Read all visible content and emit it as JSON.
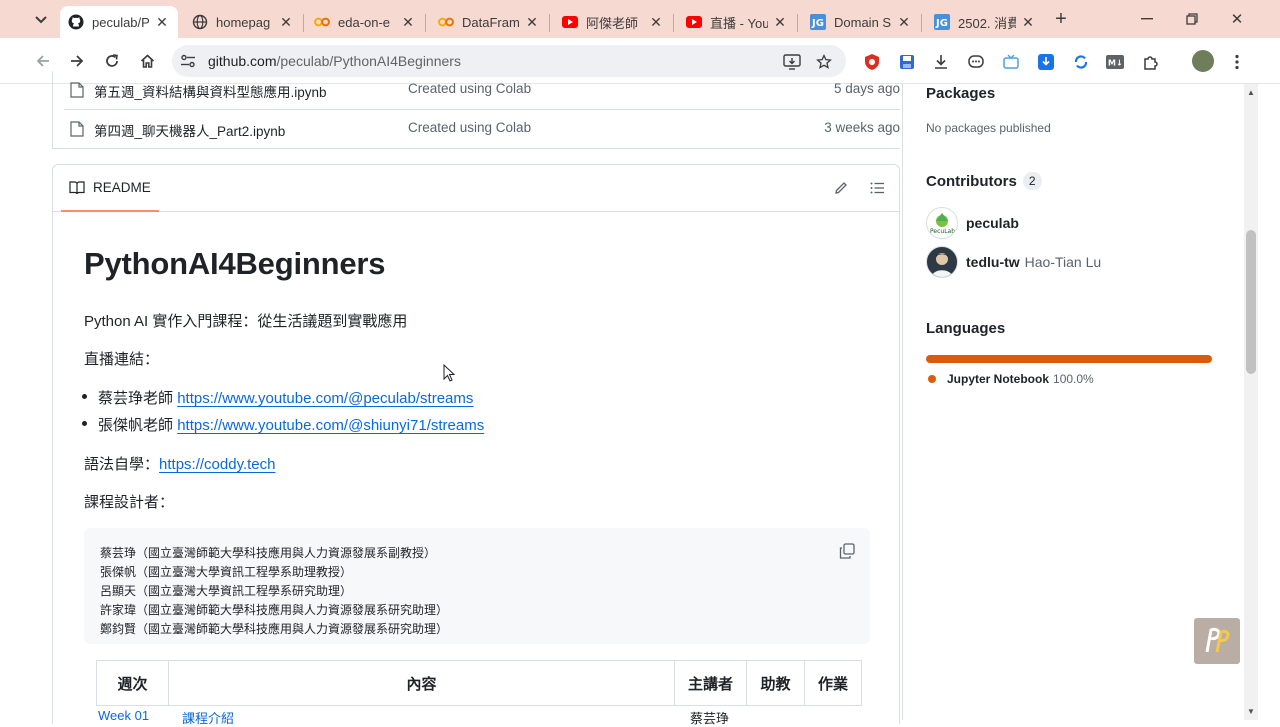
{
  "browser": {
    "tabs": [
      {
        "title": "peculab/P",
        "icon": "github-icon",
        "active": true
      },
      {
        "title": "homepag",
        "icon": "globe-icon"
      },
      {
        "title": "eda-on-e",
        "icon": "colab-icon"
      },
      {
        "title": "DataFram",
        "icon": "colab-icon"
      },
      {
        "title": "阿傑老師",
        "icon": "youtube-icon"
      },
      {
        "title": "直播 - You",
        "icon": "youtube-icon"
      },
      {
        "title": "Domain S",
        "icon": "jg-icon"
      },
      {
        "title": "2502. 消費",
        "icon": "jg-icon"
      }
    ],
    "address": {
      "host": "github.com",
      "path": "/peculab/PythonAI4Beginners"
    }
  },
  "files": [
    {
      "name": "第五週_資料結構與資料型態應用.ipynb",
      "message": "Created using Colab",
      "age": "5 days ago"
    },
    {
      "name": "第四週_聊天機器人_Part2.ipynb",
      "message": "Created using Colab",
      "age": "3 weeks ago"
    }
  ],
  "readme": {
    "tab_label": "README",
    "title": "PythonAI4Beginners",
    "subtitle": "Python AI 實作入門課程：從生活議題到實戰應用",
    "live_label": "直播連結：",
    "live_links": [
      {
        "teacher": "蔡芸琤老師",
        "url": "https://www.youtube.com/@peculab/streams"
      },
      {
        "teacher": "張傑帆老師",
        "url": "https://www.youtube.com/@shiunyi71/streams"
      }
    ],
    "self_study_label": "語法自學：",
    "self_study_url": "https://coddy.tech",
    "designers_label": "課程設計者：",
    "designers": [
      "蔡芸琤（國立臺灣師範大學科技應用與人力資源發展系副教授）",
      "張傑帆（國立臺灣大學資訊工程學系助理教授）",
      "呂顯天（國立臺灣大學資訊工程學系研究助理）",
      "許家瑋（國立臺灣師範大學科技應用與人力資源發展系研究助理）",
      "鄭鈞賢（國立臺灣師範大學科技應用與人力資源發展系研究助理）"
    ],
    "table_headers": [
      "週次",
      "內容",
      "主講者",
      "助教",
      "作業"
    ],
    "table_first_row": {
      "week": "Week 01",
      "content": "課程介紹",
      "speaker": "蔡芸琤"
    }
  },
  "sidebar": {
    "packages_title": "Packages",
    "packages_note": "No packages published",
    "contributors_title": "Contributors",
    "contributors_count": "2",
    "contributors": [
      {
        "login": "peculab",
        "name": ""
      },
      {
        "login": "tedlu-tw",
        "name": "Hao-Tian Lu"
      }
    ],
    "languages_title": "Languages",
    "languages": [
      {
        "name": "Jupyter Notebook",
        "percent": "100.0%",
        "color": "#da5b0b"
      }
    ]
  },
  "colors": {
    "tabbar": "#f6d9d0",
    "link": "#0969da",
    "accent_underline": "#fd8c73",
    "jupyter": "#da5b0b"
  }
}
